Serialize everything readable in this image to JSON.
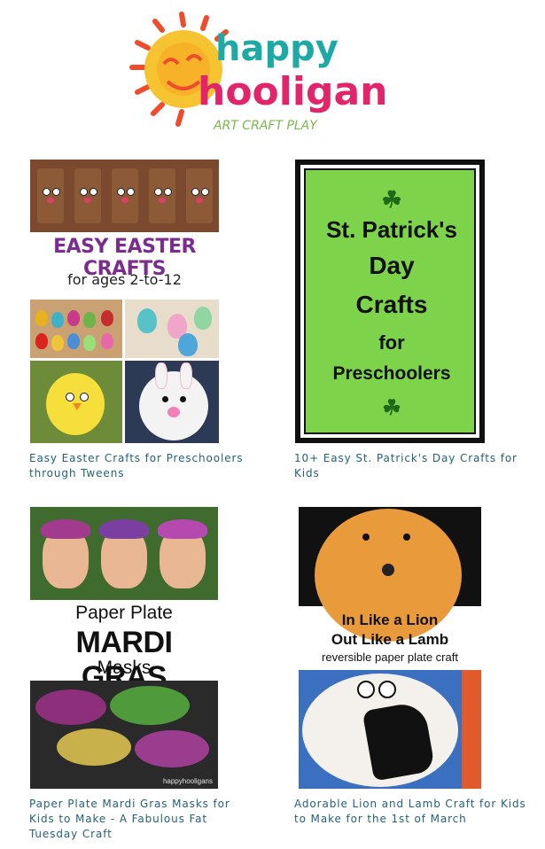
{
  "logo": {
    "line1": "happy",
    "line2": "hooligans",
    "tagline": "ART CRAFT PLAY",
    "colors": {
      "sun": "#f6c431",
      "rays": "#ef4c2d",
      "teal": "#1fa9a6",
      "pink": "#e2246b",
      "green": "#79b84a"
    }
  },
  "cards": [
    {
      "caption": "Easy Easter Crafts for Preschoolers through Tweens",
      "image": {
        "title": "EASY EASTER CRAFTS",
        "subtitle": "for ages 2-to-12"
      }
    },
    {
      "caption": "10+ Easy St. Patrick's Day Crafts for Kids",
      "image": {
        "line1": "St. Patrick's",
        "line2": "Day",
        "line3": "Crafts",
        "line4": "for",
        "line5": "Preschoolers",
        "shamrock_icon": "shamrock-icon"
      }
    },
    {
      "caption": "Paper Plate Mardi Gras Masks for Kids to Make - A Fabulous Fat Tuesday Craft",
      "image": {
        "line1": "Paper Plate",
        "line2": "MARDI GRAS",
        "line3": "Masks",
        "watermark": "happyhooligans"
      }
    },
    {
      "caption": "Adorable Lion and Lamb Craft for Kids to Make for the 1st of March",
      "image": {
        "line1": "In Like a Lion",
        "line2": "Out Like a Lamb",
        "line3": "reversible paper plate craft"
      }
    }
  ],
  "colors": {
    "caption": "#24607a",
    "stpatrick_green": "#7dd34a",
    "easter_purple": "#7a2c8f"
  }
}
